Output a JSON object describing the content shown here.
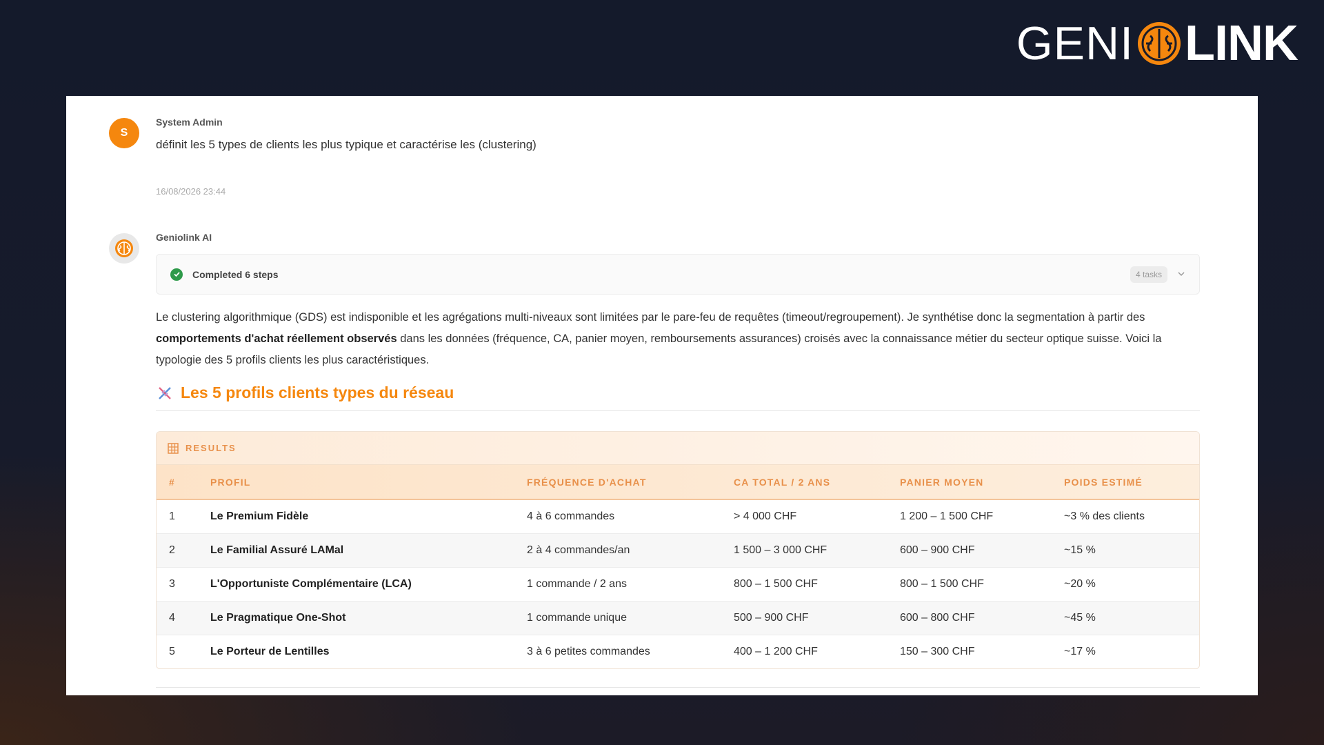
{
  "logo": {
    "left_text": "GENI",
    "right_text": "LINK",
    "accent_color": "#f5870e"
  },
  "user_message": {
    "avatar_initial": "S",
    "author": "System Admin",
    "text": "définit les 5 types de clients les plus typique et caractérise les (clustering)",
    "timestamp": "16/08/2026 23:44"
  },
  "ai_message": {
    "author": "Geniolink AI",
    "steps": {
      "label": "Completed 6 steps",
      "badge": "4 tasks"
    },
    "paragraph": {
      "part1": "Le clustering algorithmique (GDS) est indisponible et les agrégations multi-niveaux sont limitées par le pare-feu de requêtes (timeout/regroupement). Je synthétise donc la segmentation à partir des ",
      "bold": "comportements d'achat réellement observés",
      "part2": " dans les données (fréquence, CA, panier moyen, remboursements assurances) croisés avec la connaissance métier du secteur optique suisse. Voici la typologie des 5 profils clients les plus caractéristiques."
    },
    "section_title": "Les 5 profils clients types du réseau",
    "results": {
      "label": "RESULTS",
      "columns": [
        "#",
        "PROFIL",
        "FRÉQUENCE D'ACHAT",
        "CA TOTAL / 2 ANS",
        "PANIER MOYEN",
        "POIDS ESTIMÉ"
      ],
      "rows": [
        [
          "1",
          "Le Premium Fidèle",
          "4 à 6 commandes",
          "> 4 000 CHF",
          "1 200 – 1 500 CHF",
          "~3 % des clients"
        ],
        [
          "2",
          "Le Familial Assuré LAMal",
          "2 à 4 commandes/an",
          "1 500 – 3 000 CHF",
          "600 – 900 CHF",
          "~15 %"
        ],
        [
          "3",
          "L'Opportuniste Complémentaire (LCA)",
          "1 commande / 2 ans",
          "800 – 1 500 CHF",
          "800 – 1 500 CHF",
          "~20 %"
        ],
        [
          "4",
          "Le Pragmatique One-Shot",
          "1 commande unique",
          "500 – 900 CHF",
          "600 – 800 CHF",
          "~45 %"
        ],
        [
          "5",
          "Le Porteur de Lentilles",
          "3 à 6 petites commandes",
          "400 – 1 200 CHF",
          "150 – 300 CHF",
          "~17 %"
        ]
      ]
    }
  }
}
